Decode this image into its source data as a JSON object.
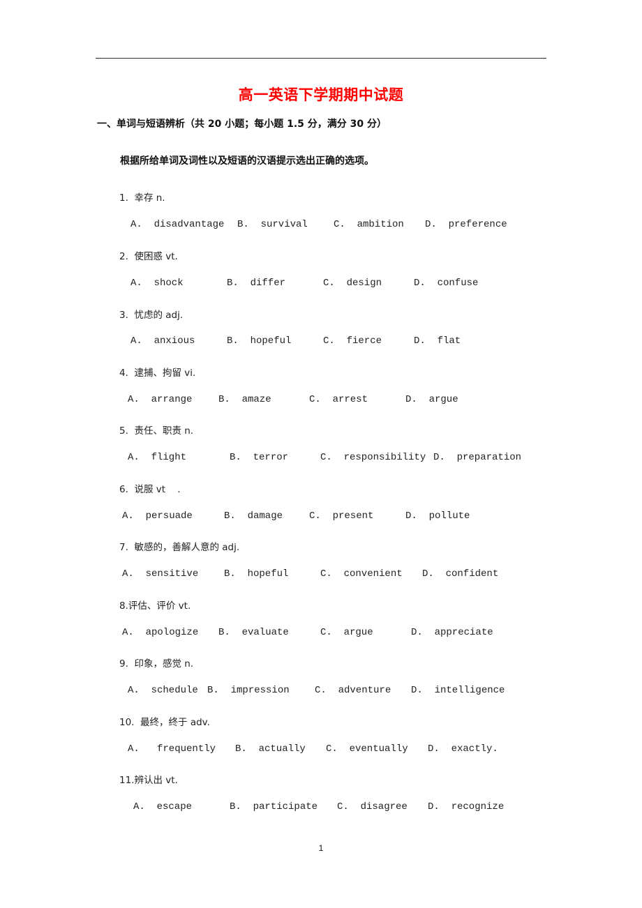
{
  "document": {
    "title": "高一英语下学期期中试题",
    "title_color": "#ff0000",
    "section_heading": "一、单词与短语辨析（共 20 小题；每小题 1.5 分，满分 30 分）",
    "instruction": "根据所给单词及词性以及短语的汉语提示选出正确的选项。",
    "page_number": "1"
  },
  "questions": [
    {
      "stem": "1.  幸存 n.",
      "options": [
        "A.  disadvantage",
        "B.  survival",
        "C.  ambition",
        "D.  preference"
      ]
    },
    {
      "stem": "2.  使困惑 vt.",
      "options": [
        "A.  shock",
        "B.  differ",
        "C.  design",
        "D.  confuse"
      ]
    },
    {
      "stem": "3.  忧虑的 adj.",
      "options": [
        "A.  anxious",
        "B.  hopeful",
        "C.  fierce",
        "D.  flat"
      ]
    },
    {
      "stem": "4.  逮捕、拘留 vi.",
      "options": [
        "A.  arrange",
        "B.  amaze",
        "C.  arrest",
        "D.  argue"
      ]
    },
    {
      "stem": "5.  责任、职责 n.",
      "options": [
        "A.  flight",
        "B.  terror",
        "C.  responsibility",
        "D.  preparation"
      ]
    },
    {
      "stem": "6.  说服 vt    .",
      "options": [
        "A.  persuade",
        "B.  damage",
        "C.  present",
        "D.  pollute"
      ]
    },
    {
      "stem": "7.  敏感的，善解人意的 adj.",
      "options": [
        "A.  sensitive",
        "B.  hopeful",
        "C.  convenient",
        "D.  confident"
      ]
    },
    {
      "stem": "8.评估、评价 vt.",
      "options": [
        "A.  apologize",
        "B.  evaluate",
        "C.  argue",
        "D.  appreciate"
      ]
    },
    {
      "stem": "9.  印象，感觉 n.",
      "options": [
        "A.  schedule",
        "B.  impression",
        "C.  adventure",
        "D.  intelligence"
      ]
    },
    {
      "stem": "10.  最终，终于 adv.",
      "options": [
        "A.   frequently",
        "B.  actually",
        "C.  eventually",
        "D.  exactly."
      ]
    },
    {
      "stem": "11.辨认出 vt.",
      "options": [
        "A.  escape",
        "B.  participate",
        "C.  disagree",
        "D.  recognize"
      ]
    }
  ]
}
